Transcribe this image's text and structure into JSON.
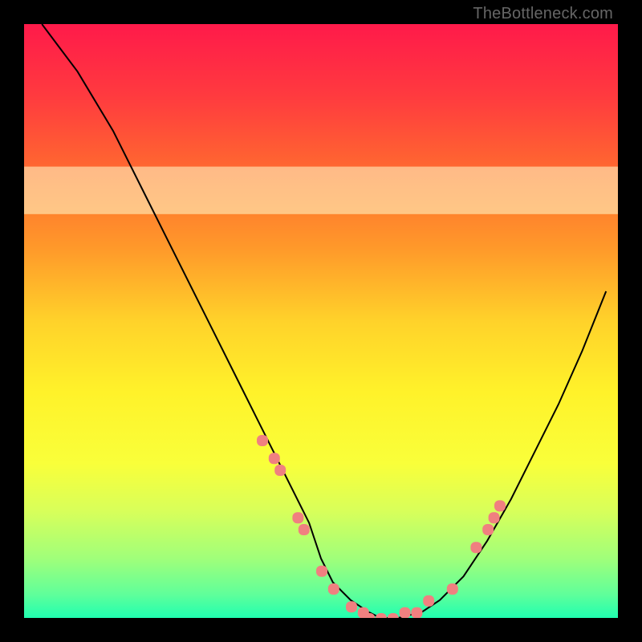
{
  "watermark": "TheBottleneck.com",
  "chart_data": {
    "type": "line",
    "title": "",
    "xlabel": "",
    "ylabel": "",
    "xlim": [
      0,
      100
    ],
    "ylim": [
      0,
      100
    ],
    "background_gradient_stops": [
      {
        "pos": 0.0,
        "color": "#ff1a4a"
      },
      {
        "pos": 0.12,
        "color": "#ff3a3f"
      },
      {
        "pos": 0.25,
        "color": "#ff6a2f"
      },
      {
        "pos": 0.38,
        "color": "#ff9a2a"
      },
      {
        "pos": 0.5,
        "color": "#ffd22a"
      },
      {
        "pos": 0.62,
        "color": "#fff22a"
      },
      {
        "pos": 0.74,
        "color": "#f9ff3a"
      },
      {
        "pos": 0.82,
        "color": "#d8ff5a"
      },
      {
        "pos": 0.9,
        "color": "#a0ff7a"
      },
      {
        "pos": 0.96,
        "color": "#60ff9a"
      },
      {
        "pos": 1.0,
        "color": "#20ffb0"
      }
    ],
    "highlight_band": {
      "from_y": 68,
      "to_y": 76,
      "color": "#ffffd0"
    },
    "series": [
      {
        "name": "bottleneck-curve",
        "color": "#000000",
        "x": [
          3,
          6,
          9,
          12,
          15,
          18,
          21,
          24,
          27,
          30,
          33,
          36,
          39,
          42,
          45,
          48,
          50,
          52,
          55,
          58,
          60,
          63,
          67,
          70,
          74,
          78,
          82,
          86,
          90,
          94,
          98
        ],
        "y": [
          100,
          96,
          92,
          87,
          82,
          76,
          70,
          64,
          58,
          52,
          46,
          40,
          34,
          28,
          22,
          16,
          10,
          6,
          3,
          1,
          0,
          0,
          1,
          3,
          7,
          13,
          20,
          28,
          36,
          45,
          55
        ]
      }
    ],
    "markers": {
      "name": "sample-points",
      "color": "#f08080",
      "points": [
        {
          "x": 40,
          "y": 30
        },
        {
          "x": 42,
          "y": 27
        },
        {
          "x": 43,
          "y": 25
        },
        {
          "x": 46,
          "y": 17
        },
        {
          "x": 47,
          "y": 15
        },
        {
          "x": 50,
          "y": 8
        },
        {
          "x": 52,
          "y": 5
        },
        {
          "x": 55,
          "y": 2
        },
        {
          "x": 57,
          "y": 1
        },
        {
          "x": 58,
          "y": 0
        },
        {
          "x": 60,
          "y": 0
        },
        {
          "x": 62,
          "y": 0
        },
        {
          "x": 64,
          "y": 1
        },
        {
          "x": 66,
          "y": 1
        },
        {
          "x": 68,
          "y": 3
        },
        {
          "x": 72,
          "y": 5
        },
        {
          "x": 76,
          "y": 12
        },
        {
          "x": 78,
          "y": 15
        },
        {
          "x": 79,
          "y": 17
        },
        {
          "x": 80,
          "y": 19
        }
      ]
    }
  }
}
